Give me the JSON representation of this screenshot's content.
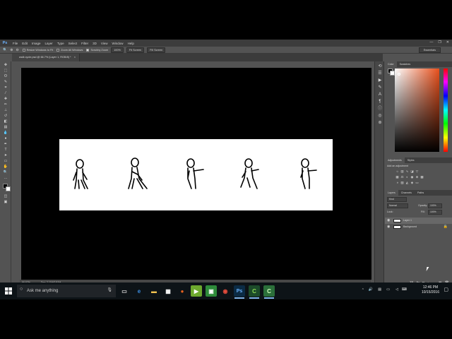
{
  "menubar": {
    "logo": "Ps",
    "items": [
      "File",
      "Edit",
      "Image",
      "Layer",
      "Type",
      "Select",
      "Filter",
      "3D",
      "View",
      "Window",
      "Help"
    ],
    "window_controls": [
      "—",
      "❐",
      "✕"
    ]
  },
  "optionsbar": {
    "zoom_in_icon": "zoom-in-icon",
    "zoom_out_icon": "zoom-out-icon",
    "resize_windows": "Resize Windows to Fit",
    "zoom_all_windows": "Zoom All Windows",
    "scrubby_zoom": "Scrubby Zoom",
    "btn_100": "100%",
    "fit_screen": "Fit Screen",
    "fill_screen": "Fill Screen",
    "workspace": "Essentials"
  },
  "document": {
    "tab_title": "walk cycle.psd @ 66.7% (Layer 1, RGB/8) *",
    "zoom": "66.67%",
    "doc_size": "Doc: 2.11M/2.81M",
    "figures": 5
  },
  "panels": {
    "color_tabs": [
      "Color",
      "Swatches"
    ],
    "adjustments_tabs": [
      "Adjustments",
      "Styles"
    ],
    "adjustments_hint": "Add an adjustment",
    "layers_tabs": [
      "Layers",
      "Channels",
      "Paths"
    ],
    "kind_label": "Kind",
    "blend_mode": "Normal",
    "opacity_label": "Opacity:",
    "opacity_value": "100%",
    "lock_label": "Lock:",
    "fill_label": "Fill:",
    "fill_value": "100%",
    "layers": [
      {
        "name": "Layer 1",
        "selected": true
      },
      {
        "name": "Background",
        "selected": false
      }
    ]
  },
  "taskbar": {
    "search_placeholder": "Ask me anything",
    "time": "12:46 PM",
    "date": "10/15/2016"
  },
  "colors": {
    "ps_gray": "#535353",
    "taskbar": "#0d1317",
    "accent_blue": "#6cb3ff"
  }
}
